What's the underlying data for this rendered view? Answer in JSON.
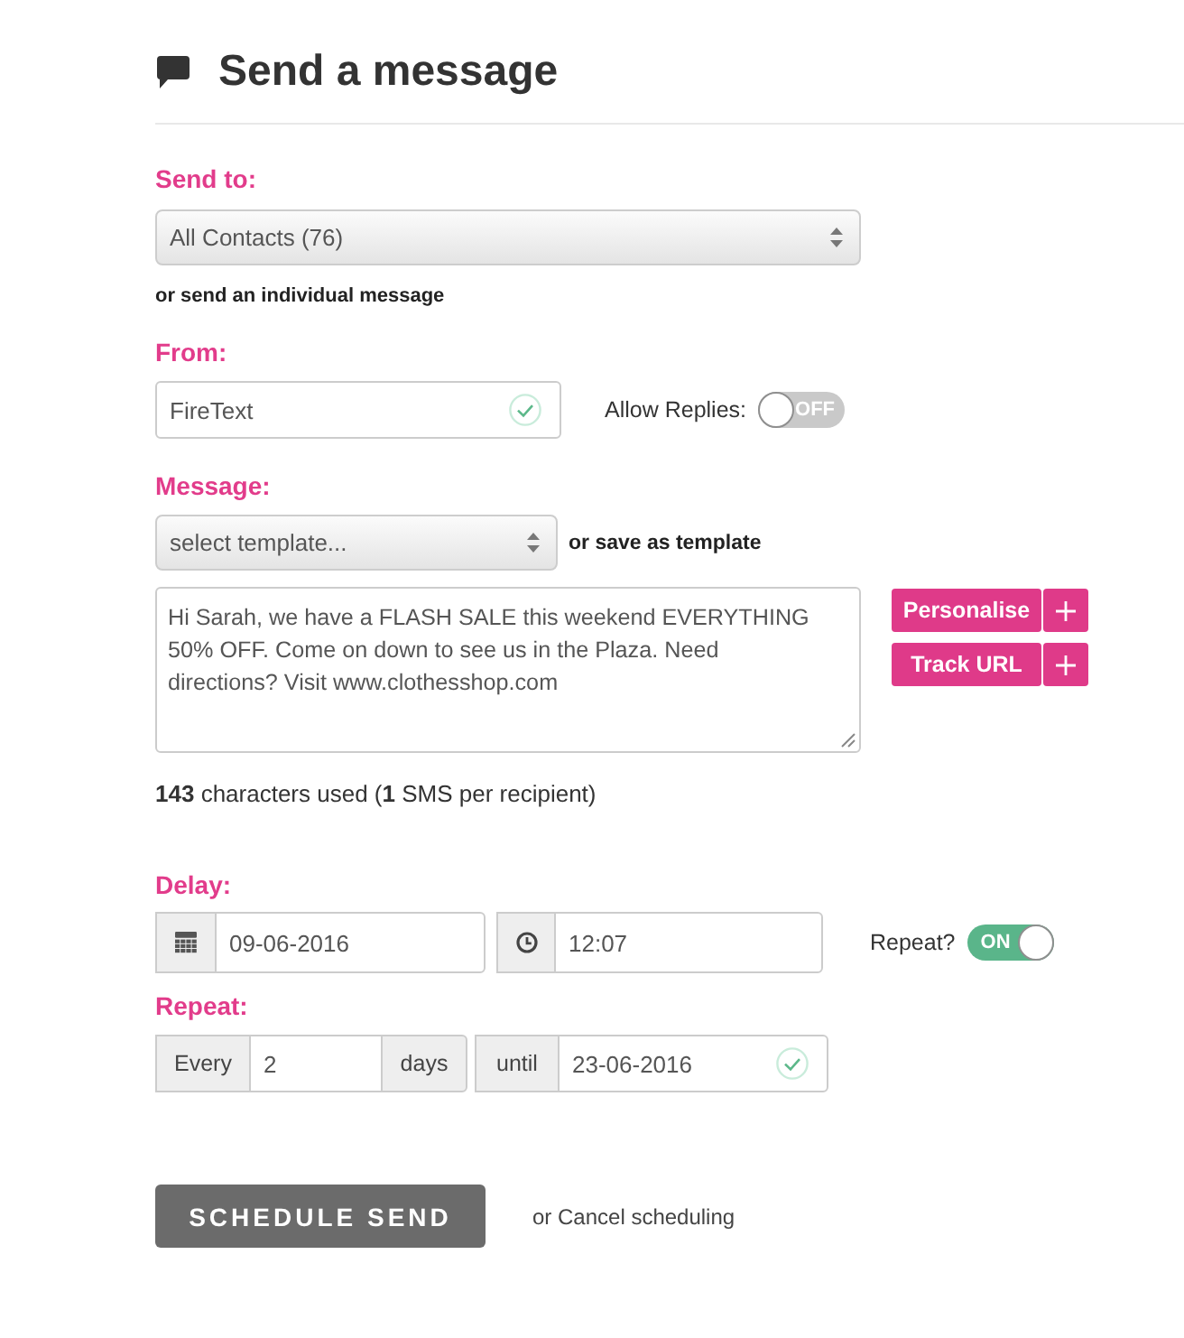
{
  "header": {
    "title": "Send a message"
  },
  "send_to": {
    "label": "Send to:",
    "select": {
      "value": "All Contacts (76)"
    },
    "alternative": "or send an individual message"
  },
  "from": {
    "label": "From:",
    "field": {
      "value": "FireText",
      "valid": true
    },
    "allow_replies": {
      "label": "Allow Replies:",
      "on": false,
      "state_text": "OFF"
    }
  },
  "message": {
    "label": "Message:",
    "template_select": {
      "value": "select template..."
    },
    "save_template": "or save as template",
    "body": "Hi Sarah, we have a FLASH SALE this weekend EVERYTHING 50% OFF. Come on down to see us in the Plaza. Need directions? Visit www.clothesshop.com",
    "actions": [
      {
        "label": "Personalise"
      },
      {
        "label": "Track URL"
      }
    ],
    "count": "**143** characters used (**1** SMS per recipient)"
  },
  "delay": {
    "label": "Delay:",
    "date": "09-06-2016",
    "time": "12:07",
    "repeat_toggle": {
      "label": "Repeat?",
      "on": true,
      "state_text": "ON"
    }
  },
  "repeat": {
    "label": "Repeat:",
    "every": {
      "prefix": "Every",
      "value": "2",
      "suffix": "days"
    },
    "until": {
      "prefix": "until",
      "value": "23-06-2016",
      "valid": true
    }
  },
  "footer": {
    "submit": "SCHEDULE SEND",
    "cancel": "or Cancel scheduling"
  }
}
